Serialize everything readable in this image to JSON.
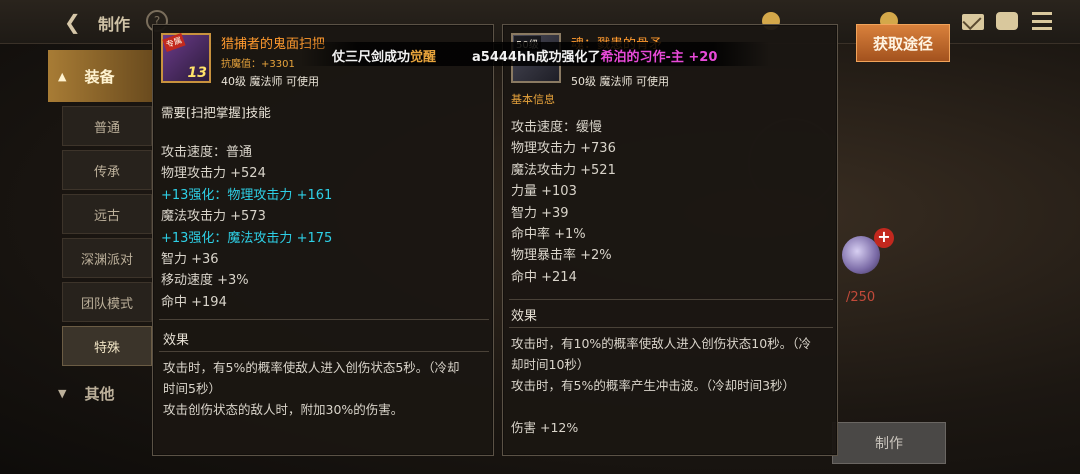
{
  "topbar": {
    "title": "制作",
    "help_icon": "?",
    "currency_1": "",
    "currency_2": ""
  },
  "sidebar": {
    "category_main": "装备",
    "items": [
      {
        "label": "普通"
      },
      {
        "label": "传承"
      },
      {
        "label": "远古"
      },
      {
        "label": "深渊派对"
      },
      {
        "label": "团队模式"
      },
      {
        "label": "特殊"
      }
    ],
    "category_other": "其他"
  },
  "broadcast": {
    "msg1_prefix": "仗三尺剑成功",
    "msg1_highlight": "觉醒",
    "msg2_prefix": "a5444hh成功强化了",
    "msg2_highlight": "希泊的习作-主 +20"
  },
  "left_item": {
    "icon_tag": "专属",
    "enhance_level": "13",
    "name": "猎捕者的鬼面扫把",
    "sub": "抗魔值：+3301",
    "req": "40级  魔法师 可使用",
    "skill_req": "需要[扫把掌握]技能",
    "stats": [
      {
        "text": "攻击速度：普通",
        "highlight": false
      },
      {
        "text": "物理攻击力 +524",
        "highlight": false
      },
      {
        "text": "+13强化：物理攻击力 +161",
        "highlight": true
      },
      {
        "text": "魔法攻击力 +573",
        "highlight": false
      },
      {
        "text": "+13强化：魔法攻击力 +175",
        "highlight": true
      },
      {
        "text": "智力 +36",
        "highlight": false
      },
      {
        "text": "移动速度 +3%",
        "highlight": false
      },
      {
        "text": "命中 +194",
        "highlight": false
      }
    ],
    "effect_title": "效果",
    "effect_lines": [
      "攻击时，有5%的概率使敌人进入创伤状态5秒。（冷却",
      "时间5秒）",
      "攻击创伤状态的敌人时，附加30%的伤害。"
    ]
  },
  "right_item": {
    "icon_level": "50级",
    "name": "魂：戮患的骨矛",
    "req": "50级  魔法师 可使用",
    "section": "基本信息",
    "stats": [
      {
        "text": "攻击速度：缓慢"
      },
      {
        "text": "物理攻击力 +736"
      },
      {
        "text": "魔法攻击力 +521"
      },
      {
        "text": "力量 +103"
      },
      {
        "text": "智力 +39"
      },
      {
        "text": "命中率 +1%"
      },
      {
        "text": "物理暴击率 +2%"
      },
      {
        "text": "命中 +214"
      }
    ],
    "effect_title": "效果",
    "effect_lines": [
      "攻击时，有10%的概率使敌人进入创伤状态10秒。（冷",
      "却时间10秒）",
      "攻击时，有5%的概率产生冲击波。（冷却时间3秒）",
      "",
      "伤害 +12%"
    ]
  },
  "right_ui": {
    "acquire_label": "获取途径",
    "craft_label": "制作",
    "cost": "/250",
    "plus": "+"
  },
  "colors": {
    "accent_orange": "#ff9a2e",
    "enhance_cyan": "#2ed0e6",
    "broadcast_pink": "#e84ad8",
    "broadcast_gold": "#e8a43c"
  }
}
